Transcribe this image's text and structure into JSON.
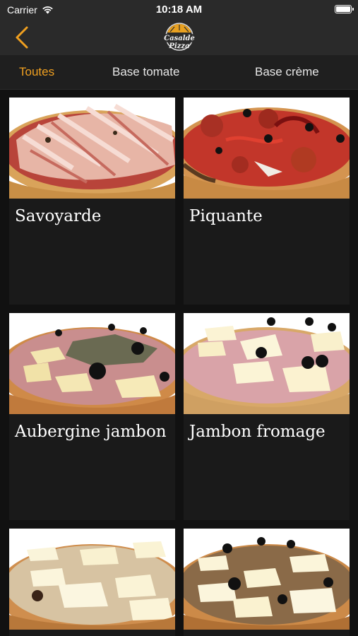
{
  "status_bar": {
    "carrier": "Carrier",
    "time": "10:18 AM"
  },
  "header": {
    "logo_text": "Casalde Pizza",
    "back_icon": "chevron-left-icon"
  },
  "tabs": [
    {
      "label": "Toutes",
      "active": true
    },
    {
      "label": "Base tomate",
      "active": false
    },
    {
      "label": "Base crème",
      "active": false
    }
  ],
  "pizzas": [
    {
      "name": "Savoyarde"
    },
    {
      "name": "Piquante"
    },
    {
      "name": "Aubergine jambon"
    },
    {
      "name": "Jambon fromage"
    },
    {
      "name": ""
    },
    {
      "name": ""
    }
  ],
  "colors": {
    "accent": "#f0a020",
    "bar": "#2a2a2a",
    "card": "#1a1a1a",
    "background": "#111111"
  }
}
